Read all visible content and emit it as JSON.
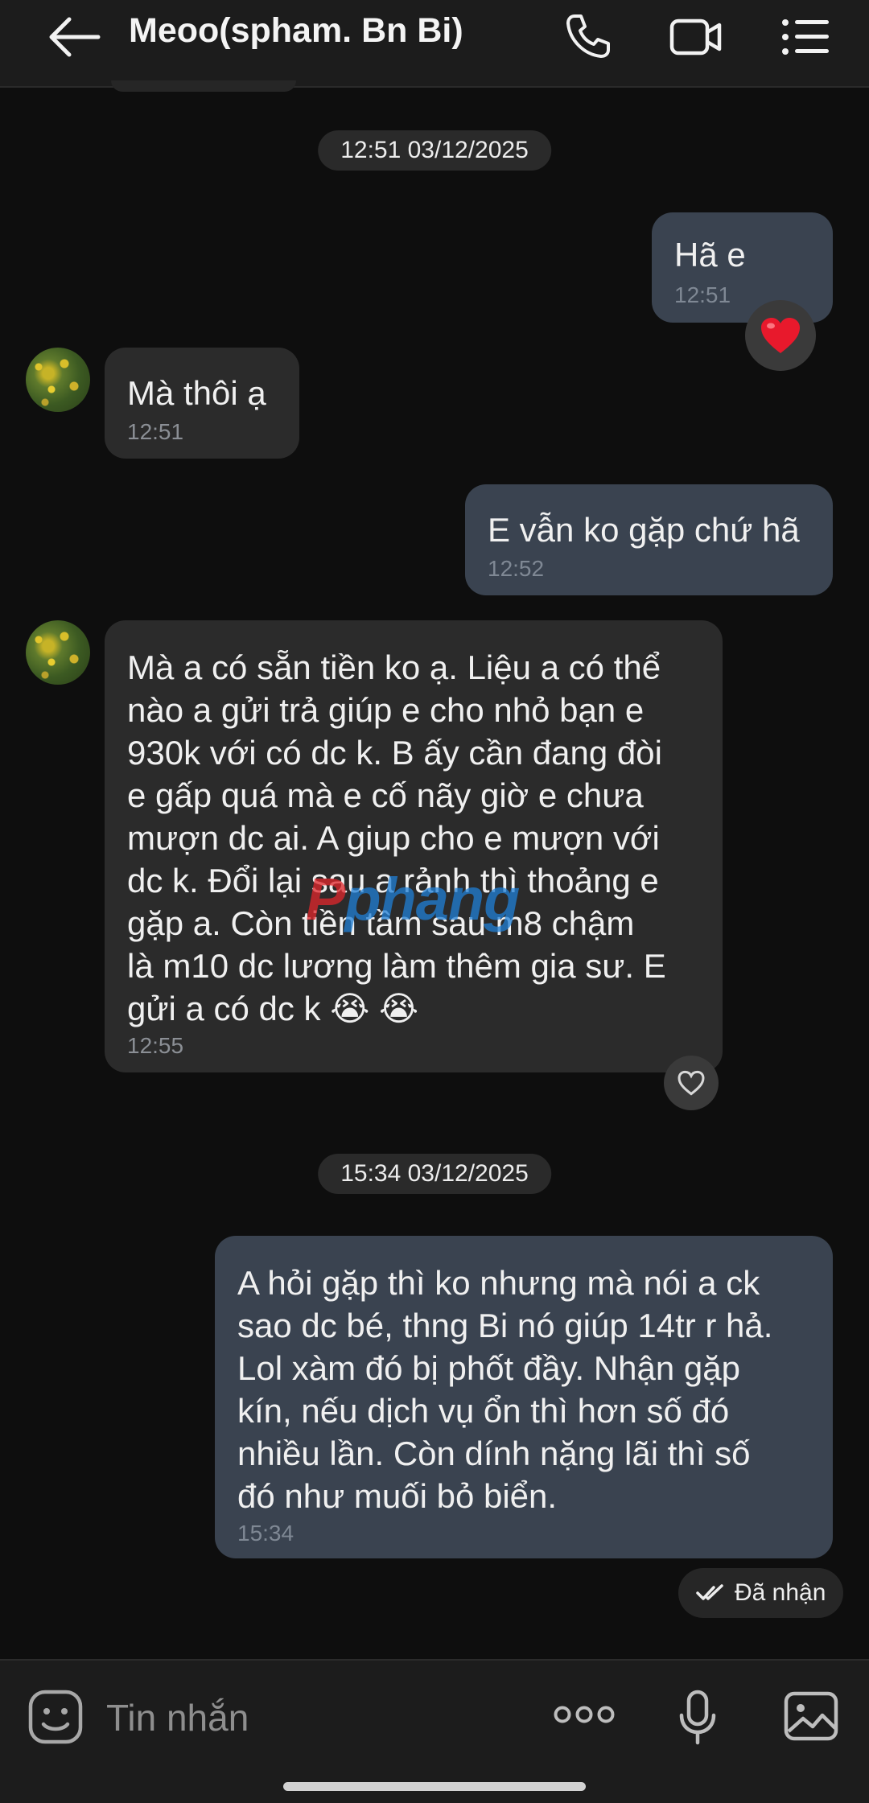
{
  "header": {
    "title": "Meoo(spham. Bn Bi)"
  },
  "messages": {
    "sep1": "12:51 03/12/2025",
    "m1": {
      "text": "Hã e",
      "time": "12:51",
      "reaction": "heart"
    },
    "m2": {
      "text": "Mà thôi ạ",
      "time": "12:51"
    },
    "m3": {
      "text": "E vẫn ko gặp chứ hã",
      "time": "12:52"
    },
    "m4": {
      "text": "Mà a có sẵn tiền ko ạ. Liệu a có thể\nnào a gửi trả giúp e cho nhỏ bạn e\n930k với có dc k. B ấy cần đang đòi\ne gấp quá mà e cố nãy giờ e chưa\nmượn dc ai. A giup cho e mượn với\ndc k. Đổi lại sau a rảnh thì thoảng e\ngặp a. Còn tiền tầm sau m8 chậm\nlà m10 dc lương làm thêm gia sư. E\ngửi a có dc k 😭 😭",
      "time": "12:55"
    },
    "sep2": "15:34 03/12/2025",
    "m5": {
      "text": "A hỏi gặp thì ko nhưng mà nói a ck\nsao dc bé, thng Bi nó giúp 14tr r hả.\nLol xàm đó bị phốt đầy. Nhận gặp\nkín, nếu dịch vụ ổn thì hơn số đó\nnhiều lần. Còn dính nặng lãi thì số\nđó như muối bỏ biển.",
      "time": "15:34"
    },
    "status": "Đã nhận"
  },
  "watermark": {
    "part1": "P",
    "part2": "phang"
  },
  "input": {
    "placeholder": "Tin nhắn"
  },
  "colors": {
    "background": "#0e0e0e",
    "incoming": "#2b2b2b",
    "outgoing": "#3a4350",
    "heart": "#e8192c"
  }
}
